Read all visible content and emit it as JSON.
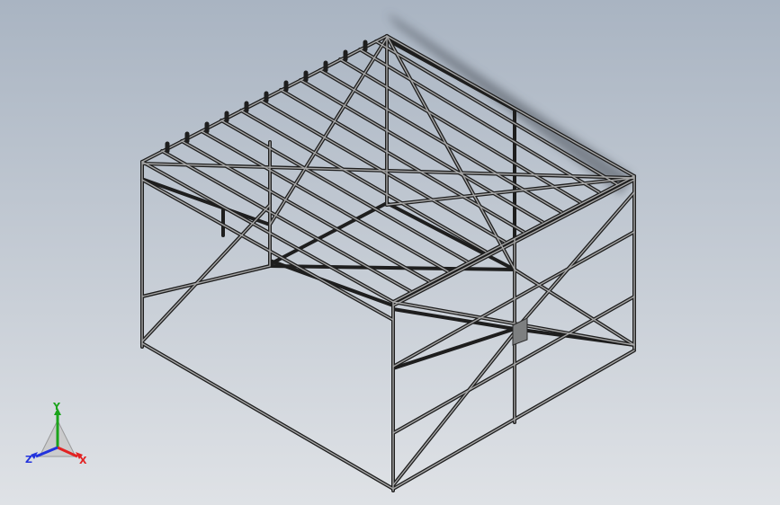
{
  "viewport": {
    "background_top": "#adb7c4",
    "background_bottom": "#dcdfe4",
    "model": "steel-frame-structure"
  },
  "triad": {
    "x_label": "X",
    "y_label": "Y",
    "z_label": "Z",
    "x_color": "#e22222",
    "y_color": "#1aa31a",
    "z_color": "#2233dd"
  }
}
